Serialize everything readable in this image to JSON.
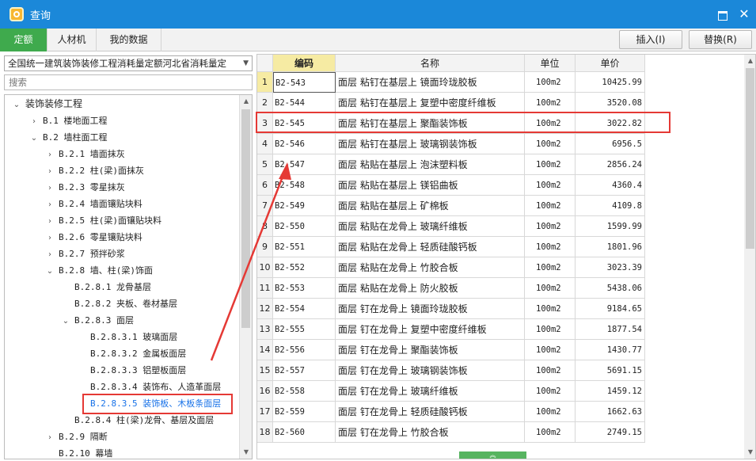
{
  "window": {
    "title": "查询"
  },
  "tabs": [
    {
      "label": "定额",
      "active": true
    },
    {
      "label": "人材机",
      "active": false
    },
    {
      "label": "我的数据",
      "active": false
    }
  ],
  "toolbar": {
    "insert_label": "插入(I)",
    "replace_label": "替换(R)"
  },
  "left": {
    "quota_select": "全国统一建筑装饰装修工程消耗量定额河北省消耗量定",
    "search_placeholder": "搜索",
    "tree": [
      {
        "label": "装饰装修工程",
        "expanded": true
      },
      {
        "label": "B.1 楼地面工程",
        "expanded": false
      },
      {
        "label": "B.2 墙柱面工程",
        "expanded": true
      },
      {
        "label": "B.2.1 墙面抹灰",
        "expanded": false
      },
      {
        "label": "B.2.2 柱(梁)面抹灰",
        "expanded": false
      },
      {
        "label": "B.2.3 零星抹灰",
        "expanded": false
      },
      {
        "label": "B.2.4 墙面镶贴块料",
        "expanded": false
      },
      {
        "label": "B.2.5 柱(梁)面镶贴块料",
        "expanded": false
      },
      {
        "label": "B.2.6 零星镶贴块料",
        "expanded": false
      },
      {
        "label": "B.2.7 预拌砂浆",
        "expanded": false
      },
      {
        "label": "B.2.8 墙、柱(梁)饰面",
        "expanded": true
      },
      {
        "label": "B.2.8.1 龙骨基层"
      },
      {
        "label": "B.2.8.2 夹板、卷材基层"
      },
      {
        "label": "B.2.8.3 面层",
        "expanded": true
      },
      {
        "label": "B.2.8.3.1 玻璃面层"
      },
      {
        "label": "B.2.8.3.2 金属板面层"
      },
      {
        "label": "B.2.8.3.3 铝塑板面层"
      },
      {
        "label": "B.2.8.3.4 装饰布、人造革面层"
      },
      {
        "label": "B.2.8.3.5 装饰板、木板条面层",
        "selected": true
      },
      {
        "label": "B.2.8.4 柱(梁)龙骨、基层及面层"
      },
      {
        "label": "B.2.9 隔断",
        "expanded": false
      },
      {
        "label": "B.2.10 幕墙"
      }
    ]
  },
  "table": {
    "columns": [
      "编码",
      "名称",
      "单位",
      "单价"
    ],
    "rows": [
      {
        "num": "1",
        "code": "B2-543",
        "name": "面层 粘钉在基层上 镜面玲珑胶板",
        "unit": "100m2",
        "price": "10425.99"
      },
      {
        "num": "2",
        "code": "B2-544",
        "name": "面层 粘钉在基层上 复塑中密度纤维板",
        "unit": "100m2",
        "price": "3520.08"
      },
      {
        "num": "3",
        "code": "B2-545",
        "name": "面层 粘钉在基层上 聚酯装饰板",
        "unit": "100m2",
        "price": "3022.82"
      },
      {
        "num": "4",
        "code": "B2-546",
        "name": "面层 粘钉在基层上 玻璃钢装饰板",
        "unit": "100m2",
        "price": "6956.5"
      },
      {
        "num": "5",
        "code": "B2-547",
        "name": "面层 粘贴在基层上 泡沫塑料板",
        "unit": "100m2",
        "price": "2856.24"
      },
      {
        "num": "6",
        "code": "B2-548",
        "name": "面层 粘贴在基层上 镁铝曲板",
        "unit": "100m2",
        "price": "4360.4"
      },
      {
        "num": "7",
        "code": "B2-549",
        "name": "面层 粘贴在基层上 矿棉板",
        "unit": "100m2",
        "price": "4109.8"
      },
      {
        "num": "8",
        "code": "B2-550",
        "name": "面层 粘贴在龙骨上 玻璃纤维板",
        "unit": "100m2",
        "price": "1599.99"
      },
      {
        "num": "9",
        "code": "B2-551",
        "name": "面层 粘贴在龙骨上 轻质硅酸钙板",
        "unit": "100m2",
        "price": "1801.96"
      },
      {
        "num": "10",
        "code": "B2-552",
        "name": "面层 粘贴在龙骨上 竹胶合板",
        "unit": "100m2",
        "price": "3023.39"
      },
      {
        "num": "11",
        "code": "B2-553",
        "name": "面层 粘贴在龙骨上 防火胶板",
        "unit": "100m2",
        "price": "5438.06"
      },
      {
        "num": "12",
        "code": "B2-554",
        "name": "面层 钉在龙骨上 镜面玲珑胶板",
        "unit": "100m2",
        "price": "9184.65"
      },
      {
        "num": "13",
        "code": "B2-555",
        "name": "面层 钉在龙骨上 复塑中密度纤维板",
        "unit": "100m2",
        "price": "1877.54"
      },
      {
        "num": "14",
        "code": "B2-556",
        "name": "面层 钉在龙骨上 聚酯装饰板",
        "unit": "100m2",
        "price": "1430.77"
      },
      {
        "num": "15",
        "code": "B2-557",
        "name": "面层 钉在龙骨上 玻璃钢装饰板",
        "unit": "100m2",
        "price": "5691.15"
      },
      {
        "num": "16",
        "code": "B2-558",
        "name": "面层 钉在龙骨上 玻璃纤维板",
        "unit": "100m2",
        "price": "1459.12"
      },
      {
        "num": "17",
        "code": "B2-559",
        "name": "面层 钉在龙骨上 轻质硅酸钙板",
        "unit": "100m2",
        "price": "1662.63"
      },
      {
        "num": "18",
        "code": "B2-560",
        "name": "面层 钉在龙骨上 竹胶合板",
        "unit": "100m2",
        "price": "2749.15"
      }
    ]
  },
  "colors": {
    "titlebar": "#1b88d9",
    "active_tab": "#3faa4d",
    "annotation": "#e53935",
    "header_highlight": "#f6eba3"
  }
}
